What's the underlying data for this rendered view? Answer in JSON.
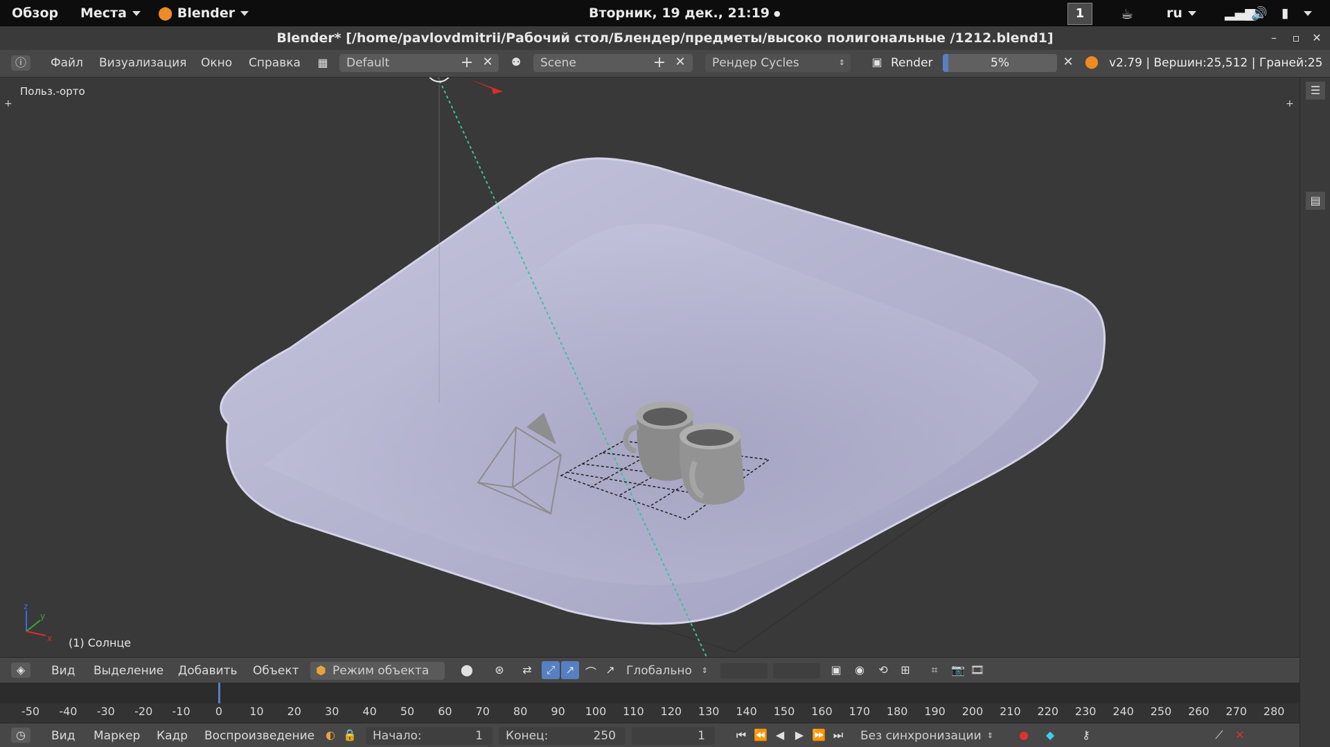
{
  "topbar": {
    "activities": "Обзор",
    "places": "Места",
    "app": "Blender",
    "datetime": "Вторник, 19 дек., 21:19",
    "workspace": "1",
    "lang": "ru"
  },
  "window": {
    "title": "Blender* [/home/pavlovdmitrii/Рабочий стол/Блендер/предметы/высоко полигональные /1212.blend1]"
  },
  "info_header": {
    "menu": [
      "Файл",
      "Визуализация",
      "Окно",
      "Справка"
    ],
    "layout": "Default",
    "scene": "Scene",
    "engine": "Рендер Cycles",
    "render_label": "Render",
    "progress_text": "5%",
    "progress": 0.05,
    "stats": "v2.79 | Вершин:25,512 | Граней:25"
  },
  "viewport": {
    "view_label": "Польз.-орто",
    "object_label": "(1) Солнце"
  },
  "view3d_header": {
    "menu": [
      "Вид",
      "Выделение",
      "Добавить",
      "Объект"
    ],
    "mode": "Режим объекта",
    "orientation": "Глобально"
  },
  "timeline": {
    "ticks": [
      "-50",
      "-40",
      "-30",
      "-20",
      "-10",
      "0",
      "10",
      "20",
      "30",
      "40",
      "50",
      "60",
      "70",
      "80",
      "90",
      "100",
      "110",
      "120",
      "130",
      "140",
      "150",
      "160",
      "170",
      "180",
      "190",
      "200",
      "210",
      "220",
      "230",
      "240",
      "250",
      "260",
      "270",
      "280"
    ],
    "current_frame_value": 0
  },
  "timeline_header": {
    "menu": [
      "Вид",
      "Маркер",
      "Кадр",
      "Воспроизведение"
    ],
    "start_label": "Начало:",
    "start_value": "1",
    "end_label": "Конец:",
    "end_value": "250",
    "current_value": "1",
    "sync": "Без синхронизации"
  },
  "colors": {
    "accent_blue": "#5680c2",
    "record_red": "#e03030",
    "axis_red": "#e02a2a",
    "axis_green": "#3aa83a",
    "keyframe_cyan": "#3ad0e8"
  }
}
